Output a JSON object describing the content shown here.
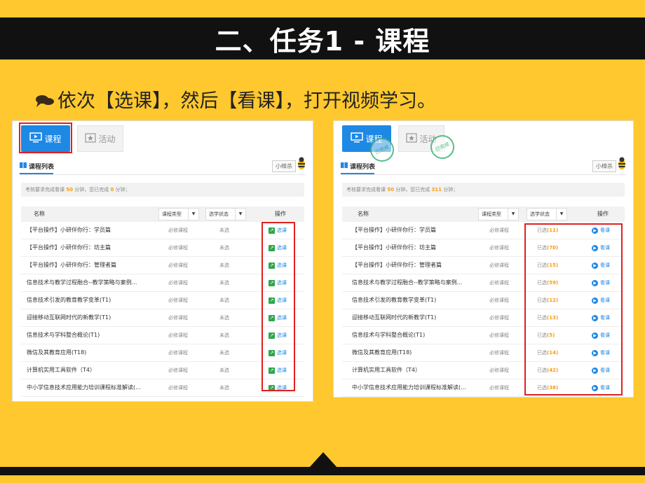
{
  "slide": {
    "title": "二、任务1 - 课程",
    "instruction": "依次【选课】，然后【看课】，打开视频学习。"
  },
  "tabs": {
    "course": "课程",
    "activity": "活动"
  },
  "list_title": "课程列表",
  "helper_button": "小樟杀",
  "notice_left": {
    "prefix": "考核要求完成看课 ",
    "required": "50",
    "mid": " 分钟，您已完成 ",
    "done": "0",
    "suffix": " 分钟；"
  },
  "notice_right": {
    "prefix": "考核要求完成看课 ",
    "required": "50",
    "mid": " 分钟，您已完成 ",
    "done": "311",
    "suffix": " 分钟；"
  },
  "columns": {
    "name": "名称",
    "type": "课程类型",
    "status": "选学状态",
    "action": "操作"
  },
  "required_label": "必修课程",
  "unselected_label": "未选",
  "selected_label": "已选",
  "select_action": "选课",
  "watch_action": "看课",
  "stamp_text": "已完成",
  "courses": [
    {
      "name": "【平台操作】小研伴你行：学员篇",
      "count": "(11)"
    },
    {
      "name": "【平台操作】小研伴你行：坊主篇",
      "count": "(70)"
    },
    {
      "name": "【平台操作】小研伴你行：管理者篇",
      "count": "(15)"
    },
    {
      "name": "信息技术与教学过程融合--教学策略与案例...",
      "count": "(59)"
    },
    {
      "name": "信息技术引发的教育教学变革(T1)",
      "count": "(12)"
    },
    {
      "name": "迎接移动互联网时代的新教学(T1)",
      "count": "(13)"
    },
    {
      "name": "信息技术与学科整合概论(T1)",
      "count": "(5)"
    },
    {
      "name": "微信及其教育应用(T18)",
      "count": "(14)"
    },
    {
      "name": "计算机实用工具软件（T4）",
      "count": "(42)"
    },
    {
      "name": "中小学信息技术应用能力培训课程标准解读(...",
      "count": "(38)"
    }
  ],
  "colors": {
    "background": "#FFC82E",
    "title_bar": "#111111",
    "accent_blue": "#1E88E5",
    "highlight_red": "#E02020"
  }
}
